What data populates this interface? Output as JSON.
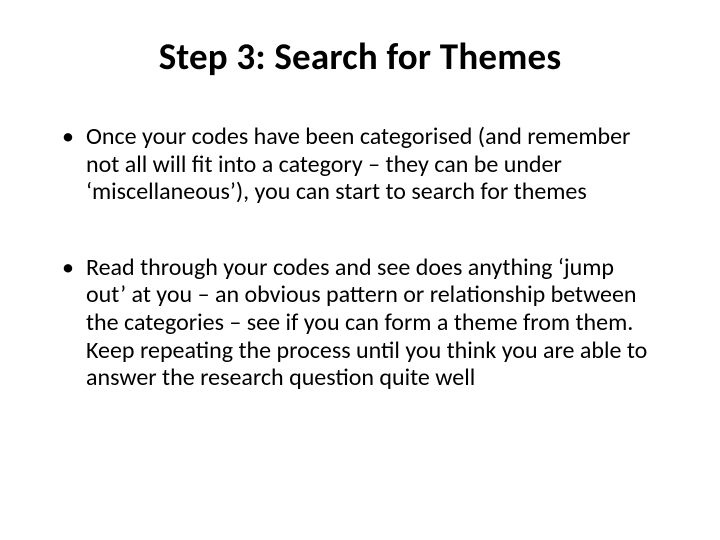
{
  "title": "Step 3: Search for Themes",
  "bullets": [
    "Once your codes have been categorised (and remember not all will fit into a category – they can be under ‘miscellaneous’), you can start to search for themes",
    "Read through your codes and see does anything ‘jump out’ at you – an obvious pattern or relationship between the categories – see if you can form a theme from them. Keep repeating the process until you think you are able to answer the research question quite well"
  ]
}
